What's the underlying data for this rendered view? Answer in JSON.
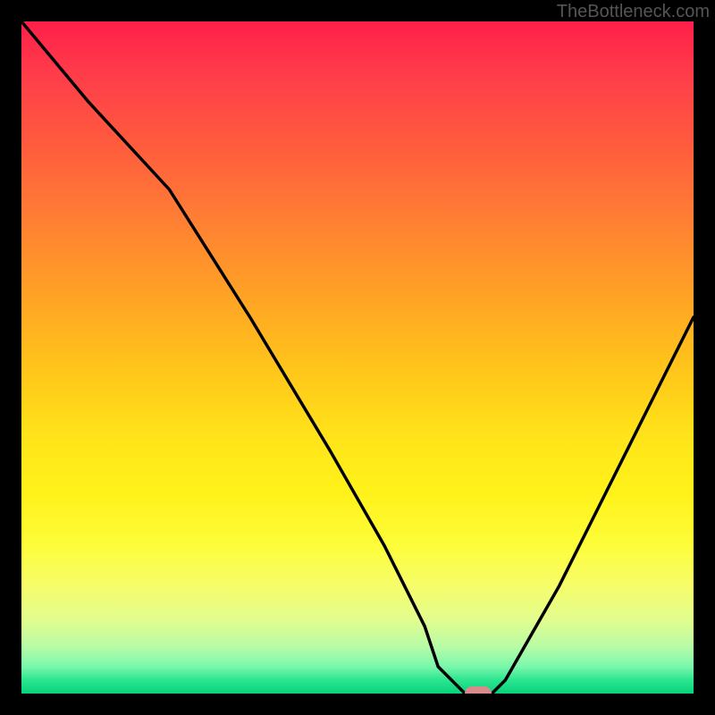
{
  "watermark": "TheBottleneck.com",
  "chart_data": {
    "type": "line",
    "title": "",
    "xlabel": "",
    "ylabel": "",
    "xlim": [
      0,
      100
    ],
    "ylim": [
      0,
      100
    ],
    "grid": false,
    "series": [
      {
        "name": "curve",
        "x": [
          0,
          10,
          22,
          34,
          46,
          54,
          60,
          62,
          66,
          70,
          72,
          80,
          88,
          96,
          100
        ],
        "values": [
          100,
          88,
          75,
          56,
          36,
          22,
          10,
          4,
          0,
          0,
          2,
          16,
          32,
          48,
          56
        ]
      }
    ],
    "marker": {
      "x": 68,
      "y": 0
    },
    "colors": {
      "curve": "#000000",
      "marker": "#d98a8a",
      "gradient_top": "#ff1f4a",
      "gradient_mid": "#ffe41a",
      "gradient_bottom": "#07d27a"
    }
  }
}
